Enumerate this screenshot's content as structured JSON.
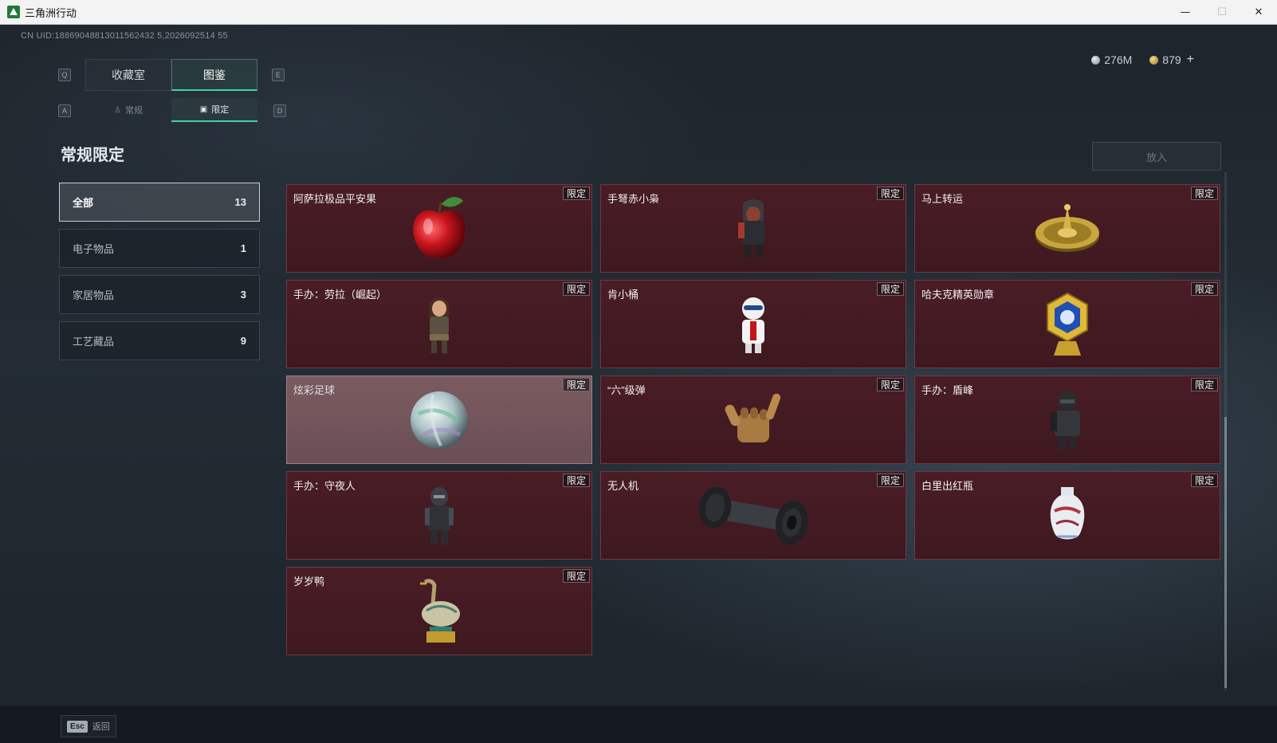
{
  "window": {
    "title": "三角洲行动",
    "minimize": "—",
    "maximize": "☐",
    "close": "✕"
  },
  "uid": "CN UID:18869048813011562432 5,2026092514 55",
  "currency": {
    "silver": "276M",
    "gold": "879",
    "add": "+"
  },
  "tabs_primary": {
    "left_key": "Q",
    "right_key": "E",
    "items": [
      {
        "label": "收藏室",
        "active": false
      },
      {
        "label": "图鉴",
        "active": true
      }
    ]
  },
  "tabs_secondary": {
    "left_key": "A",
    "right_key": "D",
    "items": [
      {
        "label": "常规",
        "icon": "figure-icon",
        "active": false
      },
      {
        "label": "限定",
        "icon": "picture-icon",
        "active": true
      }
    ]
  },
  "section_title": "常规限定",
  "put_in_button": "放入",
  "categories": [
    {
      "label": "全部",
      "count": "13",
      "active": true
    },
    {
      "label": "电子物品",
      "count": "1",
      "active": false
    },
    {
      "label": "家居物品",
      "count": "3",
      "active": false
    },
    {
      "label": "工艺藏品",
      "count": "9",
      "active": false
    }
  ],
  "badge_label": "限定",
  "items": [
    {
      "name": "阿萨拉极品平安果",
      "art": "apple-icon"
    },
    {
      "name": "手弩赤小枭",
      "art": "figurine-hooded-icon"
    },
    {
      "name": "马上转运",
      "art": "golden-wheel-icon"
    },
    {
      "name": "手办：劳拉（崛起）",
      "art": "figurine-lara-icon"
    },
    {
      "name": "肯小桶",
      "art": "figurine-colonel-icon"
    },
    {
      "name": "哈夫克精英勋章",
      "art": "medal-icon"
    },
    {
      "name": "炫彩足球",
      "art": "iridescent-ball-icon",
      "highlight": true
    },
    {
      "name": "“六”级弹",
      "art": "gesture-hand-icon"
    },
    {
      "name": "手办：盾峰",
      "art": "figurine-armored-icon"
    },
    {
      "name": "手办：守夜人",
      "art": "figurine-nightwatch-icon"
    },
    {
      "name": "无人机",
      "art": "drone-roller-icon"
    },
    {
      "name": "白里出红瓶",
      "art": "porcelain-vase-icon"
    },
    {
      "name": "岁岁鸭",
      "art": "bronze-duck-icon"
    }
  ],
  "footer": {
    "esc_key": "Esc",
    "back_label": "返回"
  },
  "colors": {
    "accent": "#38d6a1",
    "card_bg": "#4a1d25",
    "card_border": "#6c3a42"
  }
}
